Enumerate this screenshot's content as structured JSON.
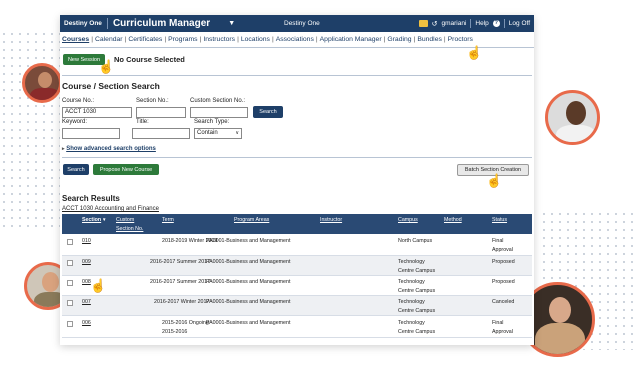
{
  "header": {
    "brand": "Destiny One",
    "module": "Curriculum Manager",
    "center_title": "Destiny One",
    "user": "gmariani",
    "help": "Help",
    "logoff": "Log Off"
  },
  "nav": {
    "items": [
      "Courses",
      "Calendar",
      "Certificates",
      "Programs",
      "Instructors",
      "Locations",
      "Associations",
      "Application Manager",
      "Grading",
      "Bundles",
      "Proctors"
    ]
  },
  "session": {
    "new_session_label": "New Session",
    "status": "No Course Selected"
  },
  "search": {
    "heading": "Course / Section Search",
    "course_no_label": "Course No.:",
    "course_no_value": "ACCT 1030",
    "section_no_label": "Section No.:",
    "custom_section_label": "Custom Section No.:",
    "search_inline_label": "Search",
    "keyword_label": "Keyword:",
    "title_label": "Title:",
    "search_type_label": "Search Type:",
    "search_type_value": "Contain",
    "advanced_link": "Show advanced search options",
    "search_button": "Search",
    "propose_button": "Propose New Course",
    "batch_button": "Batch Section Creation"
  },
  "results": {
    "heading": "Search Results",
    "course_link": "ACCT 1030 Accounting and Finance",
    "columns": {
      "section": "Section",
      "custom_1": "Custom",
      "custom_2": "Section No.",
      "term": "Term",
      "program_areas": "Program Areas",
      "instructor": "Instructor",
      "campus": "Campus",
      "method": "Method",
      "status": "Status"
    },
    "rows": [
      {
        "section": "010",
        "term": "2018-2019 Winter 2019",
        "program": "PA0001-Business and Management",
        "campus_1": "North Campus",
        "campus_2": "",
        "status_1": "Final",
        "status_2": "Approval"
      },
      {
        "section": "009",
        "term": "2016-2017 Summer 2017",
        "program": "PA0001-Business and Management",
        "campus_1": "Technology",
        "campus_2": "Centre Campus",
        "status_1": "Proposed",
        "status_2": ""
      },
      {
        "section": "008",
        "term": "2016-2017 Summer 2017",
        "program": "PA0001-Business and Management",
        "campus_1": "Technology",
        "campus_2": "Centre Campus",
        "status_1": "Proposed",
        "status_2": ""
      },
      {
        "section": "007",
        "term": "2016-2017 Winter 2017",
        "program": "PA0001-Business and Management",
        "campus_1": "Technology",
        "campus_2": "Centre Campus",
        "status_1": "Canceled",
        "status_2": ""
      },
      {
        "section": "006",
        "term": "2015-2016 Ongoing",
        "term_2": "2015-2016",
        "program": "PA0001-Business and Management",
        "campus_1": "Technology",
        "campus_2": "Centre Campus",
        "status_1": "Final",
        "status_2": "Approval"
      }
    ]
  },
  "icons": {
    "pointer": "hand-pointer-icon",
    "messages": "message-icon",
    "history": "history-icon",
    "help": "help-icon"
  },
  "colors": {
    "header": "#1e3f68",
    "green_button": "#2d7a3a",
    "avatar_ring": "#e86a4a"
  }
}
